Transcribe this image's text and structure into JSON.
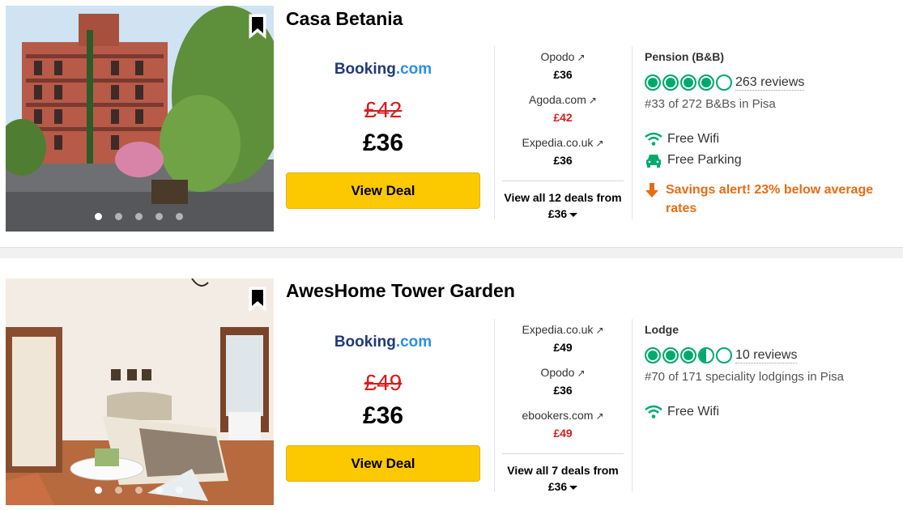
{
  "listings": [
    {
      "title": "Casa Betania",
      "main_provider": {
        "name_main": "Booking",
        "name_suffix": ".com"
      },
      "old_price": "£42",
      "price": "£36",
      "view_deal_label": "View Deal",
      "other_deals": [
        {
          "provider": "Opodo",
          "price": "£36",
          "highlight": false
        },
        {
          "provider": "Agoda.com",
          "price": "£42",
          "highlight": true
        },
        {
          "provider": "Expedia.co.uk",
          "price": "£36",
          "highlight": false
        }
      ],
      "view_all_label": "View all 12 deals from £36",
      "type": "Pension (B&B)",
      "rating": 4.5,
      "reviews": "263 reviews",
      "rank": "#33 of 272 B&Bs in Pisa",
      "amenities": [
        {
          "label": "Free Wifi",
          "icon": "wifi-icon"
        },
        {
          "label": "Free Parking",
          "icon": "car-icon"
        }
      ],
      "savings_alert": "Savings alert! 23% below average rates",
      "carousel": {
        "count": 5,
        "active": 0
      }
    },
    {
      "title": "AwesHome Tower Garden",
      "main_provider": {
        "name_main": "Booking",
        "name_suffix": ".com"
      },
      "old_price": "£49",
      "price": "£36",
      "view_deal_label": "View Deal",
      "other_deals": [
        {
          "provider": "Expedia.co.uk",
          "price": "£49",
          "highlight": false
        },
        {
          "provider": "Opodo",
          "price": "£36",
          "highlight": false
        },
        {
          "provider": "ebookers.com",
          "price": "£49",
          "highlight": true
        }
      ],
      "view_all_label": "View all 7 deals from £36",
      "type": "Lodge",
      "rating": 3.5,
      "reviews": "10 reviews",
      "rank": "#70 of 171 speciality lodgings in Pisa",
      "amenities": [
        {
          "label": "Free Wifi",
          "icon": "wifi-icon"
        }
      ],
      "carousel": {
        "count": 5,
        "active": 0
      }
    }
  ],
  "colors": {
    "button_yellow": "#fcc800",
    "rating_green": "#00aa6c",
    "price_red": "#d71c1c",
    "savings_orange": "#e96b12"
  }
}
